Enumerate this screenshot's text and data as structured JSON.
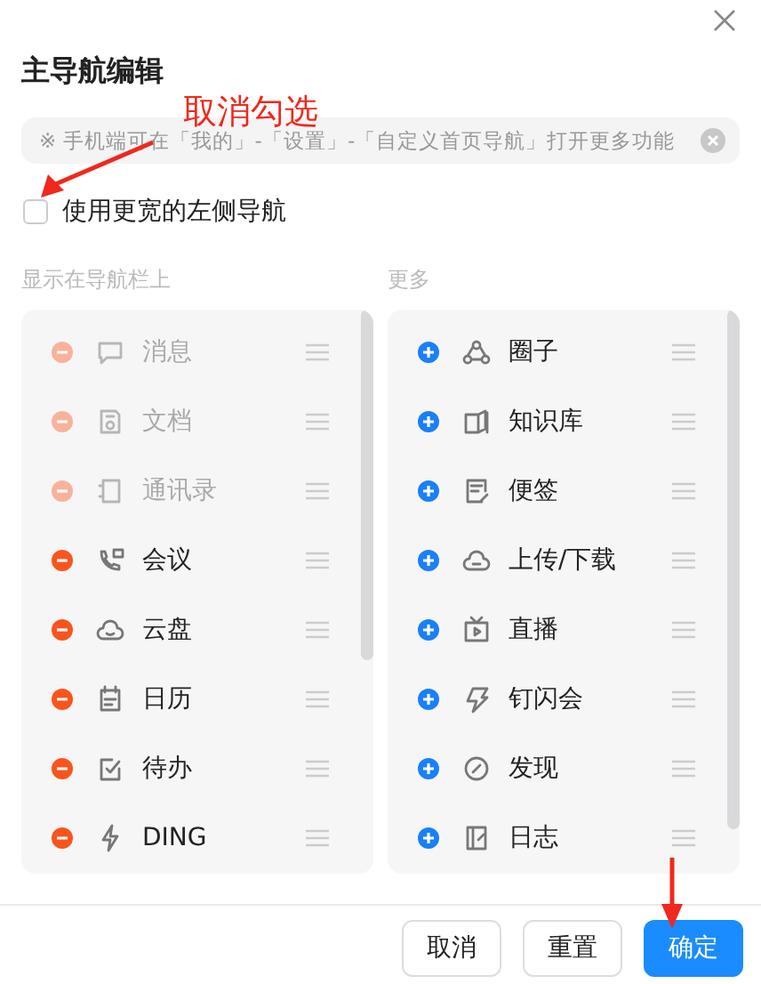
{
  "title": "主导航编辑",
  "annotation": {
    "text": "取消勾选"
  },
  "hint": {
    "text": "※ 手机端可在「我的」-「设置」-「自定义首页导航」打开更多功能"
  },
  "wide_nav": {
    "label": "使用更宽的左侧导航",
    "checked": false
  },
  "shown": {
    "label": "显示在导航栏上",
    "items": [
      {
        "label": "消息",
        "disabled": true
      },
      {
        "label": "文档",
        "disabled": true
      },
      {
        "label": "通讯录",
        "disabled": true
      },
      {
        "label": "会议",
        "disabled": false
      },
      {
        "label": "云盘",
        "disabled": false
      },
      {
        "label": "日历",
        "disabled": false
      },
      {
        "label": "待办",
        "disabled": false
      },
      {
        "label": "DING",
        "disabled": false
      }
    ]
  },
  "more": {
    "label": "更多",
    "items": [
      {
        "label": "圈子"
      },
      {
        "label": "知识库"
      },
      {
        "label": "便签"
      },
      {
        "label": "上传/下载"
      },
      {
        "label": "直播"
      },
      {
        "label": "钉闪会"
      },
      {
        "label": "发现"
      },
      {
        "label": "日志"
      }
    ]
  },
  "buttons": [
    {
      "label": "取消",
      "kind": "default"
    },
    {
      "label": "重置",
      "kind": "default"
    },
    {
      "label": "确定",
      "kind": "primary"
    }
  ]
}
